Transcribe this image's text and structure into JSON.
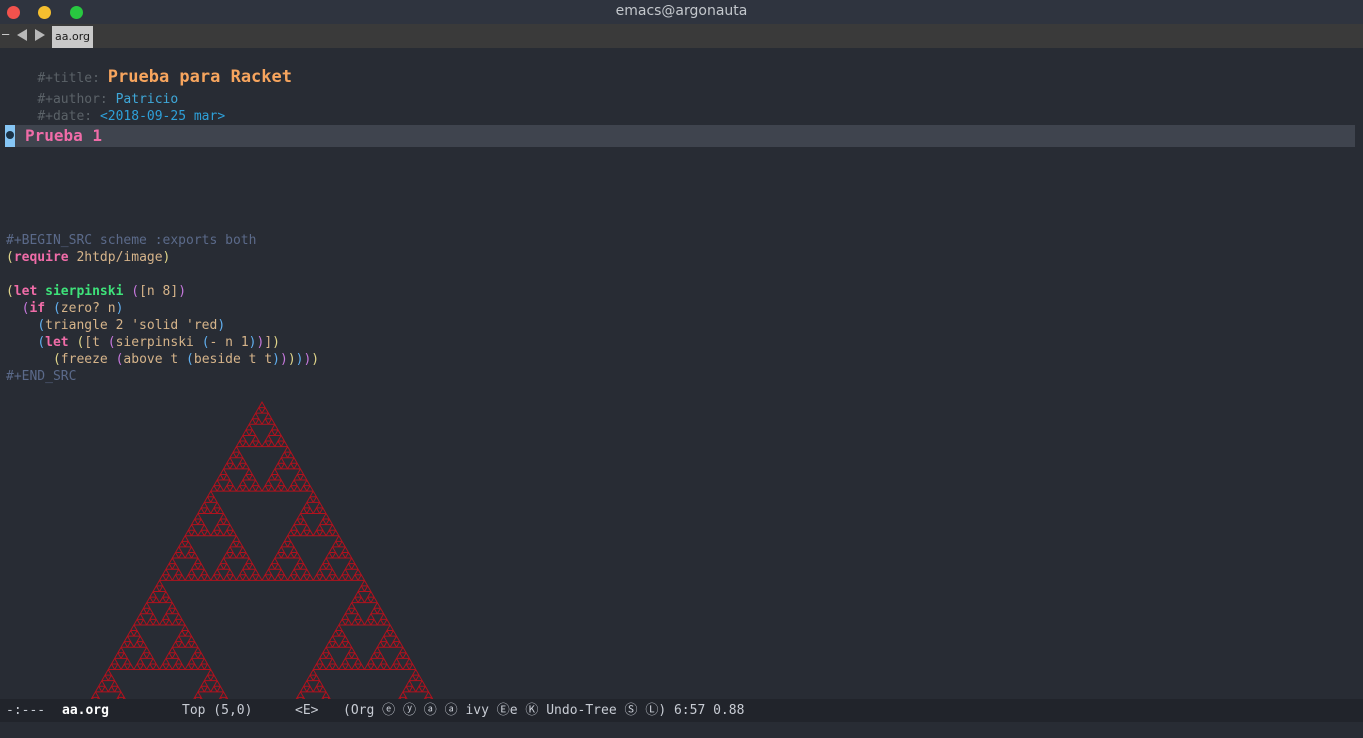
{
  "window": {
    "title": "emacs@argonauta"
  },
  "tabbar": {
    "dash": "–",
    "tab_label": "aa.org"
  },
  "org": {
    "title_key": "#+title: ",
    "title_value": "Prueba para Racket",
    "author_key": "#+author: ",
    "author_value": "Patricio",
    "date_key": "#+date: ",
    "date_value": "<2018-09-25 mar>",
    "heading": "Prueba 1"
  },
  "code": {
    "begin": "#+BEGIN_SRC scheme :exports both",
    "end": "#+END_SRC",
    "require_kw": "require",
    "require_arg": " 2htdp/image",
    "let_kw": "let",
    "let_name": "sierpinski",
    "let_bind": "[n 8]",
    "if_kw": "if",
    "if_cond": "zero? n",
    "triangle": "triangle 2 'solid 'red",
    "let2_kw": "let",
    "let2_bind_pre": "[t ",
    "let2_bind_inner": "sierpinski ",
    "let2_bind_inner2": "- n 1",
    "freeze": "freeze ",
    "above": "above t ",
    "beside": "beside t t"
  },
  "modeline": {
    "status": "-:---",
    "buffer": "aa.org",
    "position": "Top (5,0)",
    "evil_state": "<E>",
    "modes": "(Org ⓔ ⓨ ⓐ ⓐ ivy Ⓔe Ⓚ Undo-Tree Ⓢ Ⓛ) 6:57 0.88"
  },
  "colors": {
    "background": "#282c34",
    "triangle_red": "#b0121e"
  }
}
